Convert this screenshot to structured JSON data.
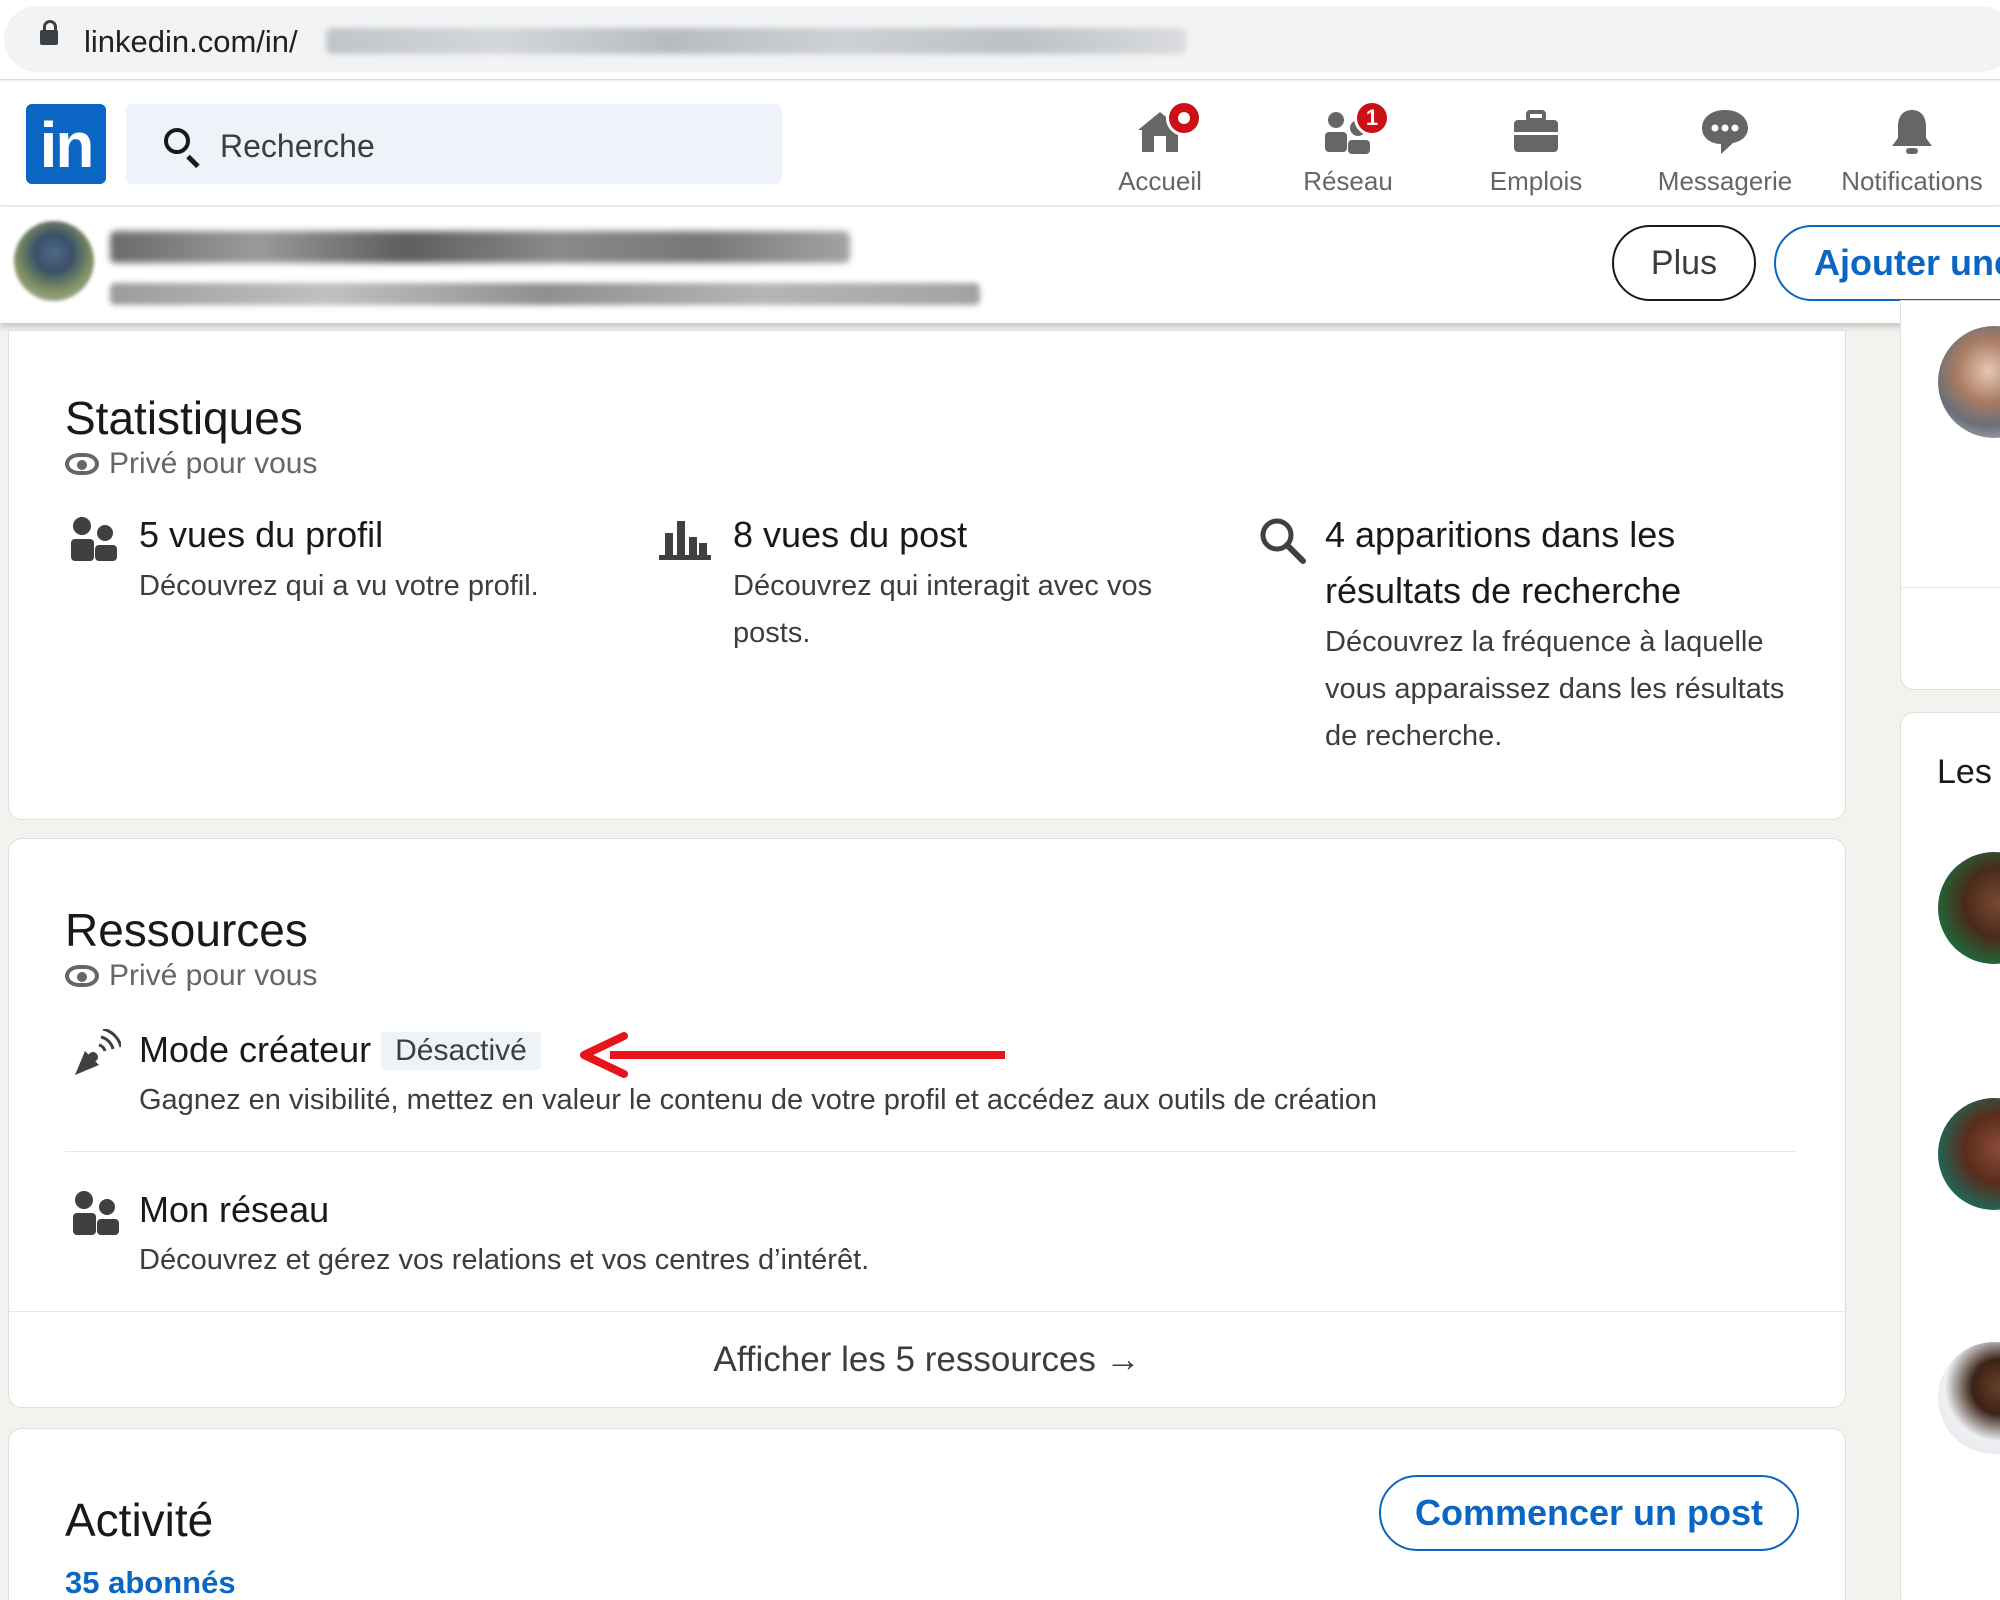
{
  "browser": {
    "url_prefix": "linkedin.com/in/"
  },
  "topnav": {
    "search_placeholder": "Recherche",
    "items": [
      {
        "label": "Accueil",
        "icon": "home-icon",
        "badge": ""
      },
      {
        "label": "Réseau",
        "icon": "network-icon",
        "badge": "1"
      },
      {
        "label": "Emplois",
        "icon": "briefcase-icon",
        "badge": ""
      },
      {
        "label": "Messagerie",
        "icon": "messaging-icon",
        "badge": ""
      },
      {
        "label": "Notifications",
        "icon": "bell-icon",
        "badge": ""
      }
    ]
  },
  "profile_bar": {
    "more_label": "Plus",
    "add_label": "Ajouter une"
  },
  "statistics": {
    "title": "Statistiques",
    "private_label": "Privé pour vous",
    "items": [
      {
        "title": "5 vues du profil",
        "desc": "Découvrez qui a vu votre profil.",
        "icon": "people-icon"
      },
      {
        "title": "8 vues du post",
        "desc": "Découvrez qui interagit avec vos posts.",
        "icon": "bar-chart-icon"
      },
      {
        "title": "4 apparitions dans les résultats de recherche",
        "desc": "Découvrez la fréquence à laquelle vous apparaissez dans les résultats de recherche.",
        "icon": "search-icon"
      }
    ]
  },
  "resources": {
    "title": "Ressources",
    "private_label": "Privé pour vous",
    "creator": {
      "title": "Mode créateur",
      "status": "Désactivé",
      "desc": "Gagnez en visibilité, mettez en valeur le contenu de votre profil et accédez aux outils de création"
    },
    "network": {
      "title": "Mon réseau",
      "desc": "Découvrez et gérez vos relations et vos centres d’intérêt."
    },
    "show_all": "Afficher les 5 ressources →"
  },
  "activity": {
    "title": "Activité",
    "followers": "35 abonnés",
    "start_post": "Commencer un post"
  },
  "sidebar": {
    "section_partial": "Les"
  },
  "colors": {
    "brand": "#0a66c2",
    "badge": "#cc1016",
    "annotation_arrow": "#e8141b"
  }
}
